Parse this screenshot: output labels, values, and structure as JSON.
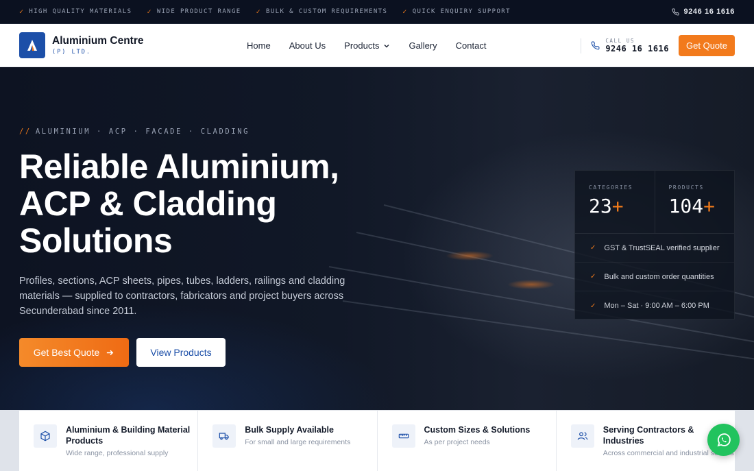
{
  "topbar": {
    "features": [
      {
        "label": "HIGH QUALITY MATERIALS"
      },
      {
        "label": "WIDE PRODUCT RANGE"
      },
      {
        "label": "BULK & CUSTOM REQUIREMENTS"
      },
      {
        "label": "QUICK ENQUIRY SUPPORT"
      }
    ],
    "phone": "9246 16 1616"
  },
  "nav": {
    "brand_title": "Aluminium Centre",
    "brand_sub": "(P) LTD.",
    "menu": [
      {
        "label": "Home"
      },
      {
        "label": "About Us"
      },
      {
        "label": "Products"
      },
      {
        "label": "Gallery"
      },
      {
        "label": "Contact"
      }
    ],
    "call_label": "CALL US",
    "call_number": "9246 16 1616",
    "quote_label": "Get Quote"
  },
  "hero": {
    "eyebrow_prefix": "//",
    "eyebrow": "ALUMINIUM · ACP · FACADE · CLADDING",
    "headline": "Reliable Aluminium, ACP & Cladding Solutions",
    "description": "Profiles, sections, ACP sheets, pipes, tubes, ladders, railings and cladding materials — supplied to contractors, fabricators and project buyers across Secunderabad since 2011.",
    "primary_cta": "Get Best Quote",
    "secondary_cta": "View Products"
  },
  "stats": {
    "items": [
      {
        "label": "CATEGORIES",
        "value": "23",
        "suffix": "+"
      },
      {
        "label": "PRODUCTS",
        "value": "104",
        "suffix": "+"
      }
    ],
    "checks": [
      {
        "text": "GST & TrustSEAL verified supplier"
      },
      {
        "text": "Bulk and custom order quantities"
      },
      {
        "text": "Mon – Sat · 9:00 AM – 6:00 PM"
      }
    ]
  },
  "features": [
    {
      "title": "Aluminium & Building Material Products",
      "subtitle": "Wide range, professional supply",
      "icon": "cube-icon"
    },
    {
      "title": "Bulk Supply Available",
      "subtitle": "For small and large requirements",
      "icon": "truck-icon"
    },
    {
      "title": "Custom Sizes & Solutions",
      "subtitle": "As per project needs",
      "icon": "ruler-icon"
    },
    {
      "title": "Serving Contractors & Industries",
      "subtitle": "Across commercial and industrial sectors",
      "icon": "users-icon"
    }
  ],
  "colors": {
    "accent": "#f27a1c",
    "brand_blue": "#1c4fa8",
    "whatsapp": "#22c35e"
  }
}
